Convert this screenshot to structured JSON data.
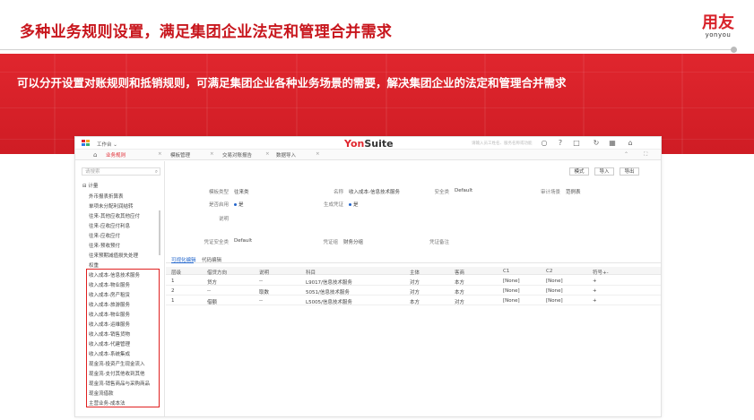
{
  "slide": {
    "title": "多种业务规则设置，满足集团企业法定和管理合并需求",
    "logo_cn": "用友",
    "logo_en": "yonyou",
    "banner_text": "可以分开设置对账规则和抵销规则，可满足集团企业各种业务场景的需要，解决集团企业的法定和管理合并需求"
  },
  "app": {
    "workbench": "工作台 ⌄",
    "brand_left": "Yon",
    "brand_right": "Suite",
    "search_placeholder": "请输入员工姓名、服务名称或功能",
    "tabs": [
      "业务规则",
      "模板管理",
      "交易对账报告",
      "数据导入"
    ],
    "sidebar": {
      "search_placeholder": "请搜索",
      "root": "计量",
      "items": [
        "外币报表折算表",
        "单项未分配利润结转",
        "往来-其他应收其他应付",
        "往来-应收应付利息",
        "往来-应收应付",
        "往来-预收预付",
        "往来预期减值损失处理",
        "权重",
        "收入成本-信息技术服务",
        "收入成本-物业服务",
        "收入成本-房产租赁",
        "收入成本-旅游服务",
        "收入成本-物业服务",
        "收入成本-运维服务",
        "收入成本-销售货物",
        "收入成本-代建管理",
        "收入成本-系统集成",
        "现金流-投资产生现金流入",
        "现金流-支付其他收到其他",
        "现金流-销售商品与采购商品",
        "现金流借款",
        "主营业务-成本法"
      ]
    },
    "buttons": [
      "模式",
      "导入",
      "导出"
    ],
    "form": {
      "model_type_label": "模板类型",
      "model_type_value": "往来类",
      "name_label": "名称",
      "name_value": "收入成本-信息技术服务",
      "security_label": "安全类",
      "security_value": "Default",
      "audit_label": "审计场景",
      "audit_value": "范例表",
      "enabled_label": "是否启用",
      "enabled_value": "是",
      "generate_label": "生成凭证",
      "generate_value": "是",
      "desc_label": "说明",
      "voucher_security_label": "凭证安全类",
      "voucher_security_value": "Default",
      "voucher_type_label": "凭证组",
      "voucher_type_value": "财务分组",
      "voucher_note_label": "凭证备注"
    },
    "subtabs": [
      "可视化编辑",
      "代码编辑"
    ],
    "table": {
      "headers": [
        "层级",
        "借贷方向",
        "说明",
        "科目",
        "主体",
        "客商",
        "C1",
        "C2",
        "符号+-"
      ],
      "rows": [
        [
          "1",
          "贷方",
          "--",
          "L9017/信息技术服务",
          "对方",
          "本方",
          "[None]",
          "[None]",
          "+"
        ],
        [
          "2",
          "--",
          "取数",
          "5051/信息技术服务",
          "对方",
          "本方",
          "[None]",
          "[None]",
          "+"
        ],
        [
          "1",
          "借额",
          "--",
          "L5005/信息技术服务",
          "本方",
          "对方",
          "[None]",
          "[None]",
          "+"
        ]
      ]
    }
  }
}
